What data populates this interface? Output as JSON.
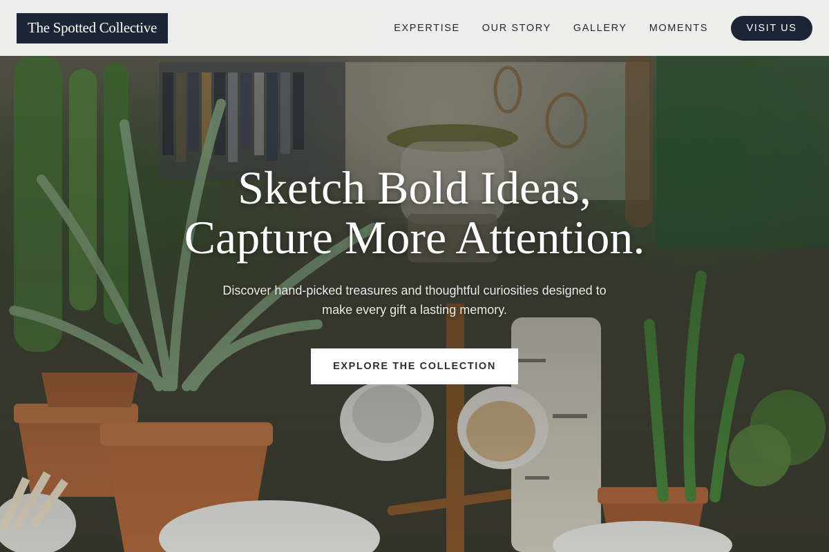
{
  "header": {
    "logo_text": "The Spotted Collective",
    "nav": [
      {
        "label": "EXPERTISE"
      },
      {
        "label": "OUR STORY"
      },
      {
        "label": "GALLERY"
      },
      {
        "label": "MOMENTS"
      }
    ],
    "cta_label": "VISIT US"
  },
  "hero": {
    "headline_line1": "Sketch Bold Ideas,",
    "headline_line2": "Capture More Attention.",
    "sub_line1": "Discover hand-picked treasures and thoughtful curiosities designed to",
    "sub_line2": "make every gift a lasting memory.",
    "cta_label": "EXPLORE THE COLLECTION"
  },
  "colors": {
    "brand_navy": "#1c2536",
    "header_bg": "#f6f6f6",
    "cta_bg": "#ffffff"
  }
}
